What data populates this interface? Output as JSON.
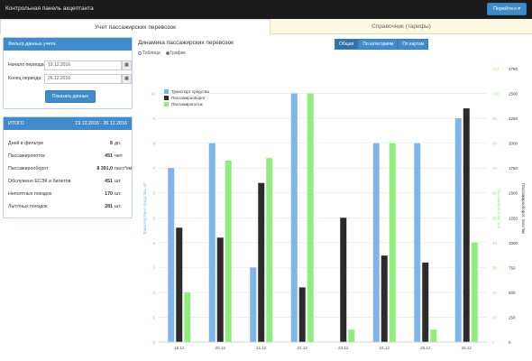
{
  "app": {
    "title": "Контрольная панель акцептанта",
    "goto_label": "Перейти к ▾"
  },
  "tabs": [
    {
      "label": "Учет пассажирских перевозок",
      "active": true
    },
    {
      "label": "Справочник (тарифы)",
      "active": false
    }
  ],
  "filter": {
    "header": "Фильтр данных учета",
    "start_label": "Начало периода:",
    "start_value": "19.12.2016",
    "end_label": "Конец периода:",
    "end_value": "26.12.2016",
    "show_button": "Показать данные учета"
  },
  "totals": {
    "header": "ИТОГО",
    "period": "19.12.2016 - 26.12.2016",
    "rows": [
      {
        "label": "Дней в фильтре",
        "value": "8",
        "unit": "дн."
      },
      {
        "label": "Пассажиропоток",
        "value": "451",
        "unit": "чел"
      },
      {
        "label": "Пассажирооборот",
        "value": "8 391,0",
        "unit": "пасс*км"
      },
      {
        "label": "Обслужено ЕСЭК и билетов",
        "value": "451",
        "unit": "шт."
      },
      {
        "label": "Неполтных поездок",
        "value": "170",
        "unit": "шт."
      },
      {
        "label": "Льготных поездок",
        "value": "281",
        "unit": "шт."
      }
    ]
  },
  "chart_panel": {
    "title": "Динамика пассажирских перевозок",
    "view_options": [
      "Таблица",
      "График"
    ],
    "selected_view": "График",
    "mode_buttons": [
      "Общая",
      "По категориям",
      "По картам"
    ],
    "selected_mode": "Общая"
  },
  "chart_data": {
    "type": "bar",
    "categories": [
      "19.12",
      "20.12",
      "21.12",
      "22.12",
      "23.12",
      "24.12",
      "25.12",
      "26.12"
    ],
    "series": [
      {
        "name": "Транспорт средства",
        "axis": "left",
        "color": "#7eb6ec",
        "values": [
          7,
          8,
          3,
          10,
          0,
          8,
          8,
          9
        ]
      },
      {
        "name": "Пассажирооборот",
        "axis": "far-right",
        "color": "#2b2b2b",
        "values": [
          1150,
          1050,
          1600,
          550,
          1250,
          870,
          800,
          2350
        ]
      },
      {
        "name": "Пассажиропоток",
        "axis": "right",
        "color": "#90ed7d",
        "values": [
          20,
          73,
          74,
          100,
          5,
          80,
          5,
          40
        ]
      }
    ],
    "left_axis": {
      "label": "Транспортные средства, шт",
      "ticks": [
        0,
        1,
        2,
        3,
        4,
        5,
        6,
        7,
        8,
        9,
        10
      ],
      "ylim": [
        0,
        11
      ]
    },
    "right_axis": {
      "label": "Пассажиропоток, чел",
      "ticks": [
        0,
        10,
        20,
        30,
        40,
        50,
        60,
        70,
        80,
        90,
        100,
        110
      ],
      "ylim": [
        0,
        110
      ]
    },
    "far_right_axis": {
      "label": "Пассажирооборот, пасс*км",
      "ticks": [
        0,
        250,
        500,
        750,
        1000,
        1250,
        1500,
        1750,
        2000,
        2250,
        2500,
        2750
      ],
      "ylim": [
        0,
        2750
      ]
    },
    "legend_position": "top-left",
    "grid": true
  }
}
